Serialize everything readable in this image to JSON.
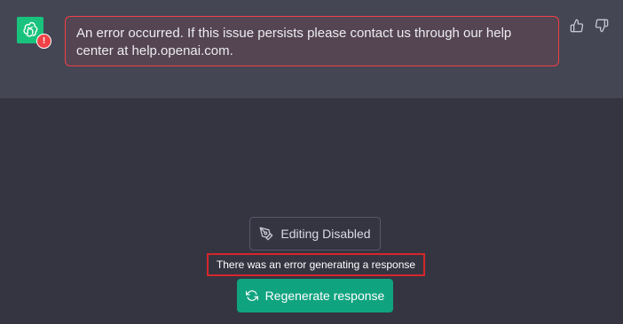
{
  "message": {
    "avatar_icon": "openai-logo-icon",
    "error_badge": "!",
    "error_text": "An error occurred. If this issue persists please contact us through our help center at help.openai.com.",
    "feedback": {
      "thumb_up_icon": "thumbs-up-icon",
      "thumb_down_icon": "thumbs-down-icon"
    }
  },
  "composer": {
    "edit_disabled_label": "Editing Disabled",
    "edit_disabled_icon": "pen-off-icon",
    "error_notice": "There was an error generating a response",
    "regenerate_label": "Regenerate response",
    "regenerate_icon": "refresh-icon"
  },
  "colors": {
    "background": "#343541",
    "message_background": "#444654",
    "error": "#ef4146",
    "accent": "#10a37f"
  }
}
